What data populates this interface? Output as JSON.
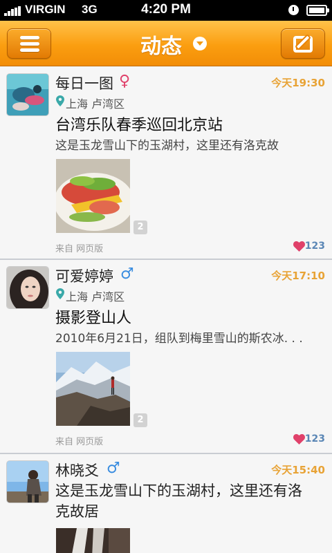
{
  "status_bar": {
    "carrier": "VIRGIN",
    "network": "3G",
    "time": "4:20 PM"
  },
  "nav": {
    "title": "动态",
    "menu_icon": "hamburger-menu-icon",
    "compose_icon": "compose-icon",
    "dropdown_icon": "dropdown-arrow-icon",
    "accent_color": "#f89a0f"
  },
  "posts": [
    {
      "username": "每日一图",
      "gender": "♀",
      "time": "今天19:30",
      "location": "上海 卢湾区",
      "title": "台湾乐队春季巡回北京站",
      "text": "这是玉龙雪山下的玉湖村，这里还有洛克故",
      "image_count": "2",
      "source": "来自  网页版",
      "likes": "123"
    },
    {
      "username": "可爱婷婷",
      "gender": "♂",
      "time": "今天17:10",
      "location": "上海 卢湾区",
      "title": "摄影登山人",
      "text": "2010年6月21日，组队到梅里雪山的斯农冰. . .",
      "image_count": "2",
      "source": "来自  网页版",
      "likes": "123"
    },
    {
      "username": "林晓爻",
      "gender": "♂",
      "time": "今天15:40",
      "text_line1": "这是玉龙雪山下的玉湖村，这里还有洛",
      "text_line2": "克故居"
    }
  ],
  "colors": {
    "time_orange": "#e8a336",
    "like_blue": "#5a86b5",
    "heart_red": "#e0416a",
    "pin_teal": "#3aa9a9"
  }
}
